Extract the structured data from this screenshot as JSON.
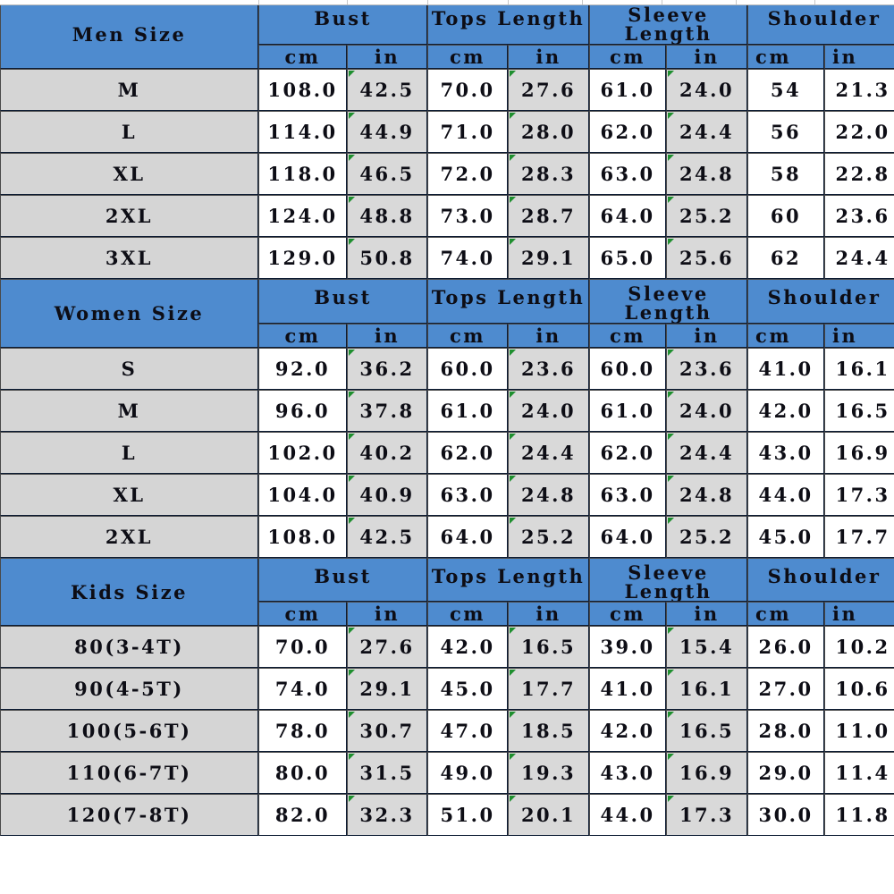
{
  "meta": {
    "colors": {
      "header_blue": "#4e8bcf",
      "row_gray": "#d5d5d5",
      "value_gray": "#d9d9d9",
      "value_white": "#ffffff",
      "text": "#0d0d15",
      "grid_dark": "#0c1b33",
      "error_marker_green": "#1f8f2f"
    }
  },
  "units": {
    "cm": "cm",
    "in": "in"
  },
  "measurements": {
    "bust": "Bust",
    "tops_length": "Tops Length",
    "sleeve_line1": "Sleeve",
    "sleeve_line2": "Length",
    "shoulder": "Shoulder"
  },
  "sections": [
    {
      "id": "men",
      "title": "Men Size",
      "rows": [
        {
          "size": "M",
          "bust_cm": "108.0",
          "bust_in": "42.5",
          "tops_cm": "70.0",
          "tops_in": "27.6",
          "sleeve_cm": "61.0",
          "sleeve_in": "24.0",
          "shoulder_cm": "54",
          "shoulder_in": "21.3"
        },
        {
          "size": "L",
          "bust_cm": "114.0",
          "bust_in": "44.9",
          "tops_cm": "71.0",
          "tops_in": "28.0",
          "sleeve_cm": "62.0",
          "sleeve_in": "24.4",
          "shoulder_cm": "56",
          "shoulder_in": "22.0"
        },
        {
          "size": "XL",
          "bust_cm": "118.0",
          "bust_in": "46.5",
          "tops_cm": "72.0",
          "tops_in": "28.3",
          "sleeve_cm": "63.0",
          "sleeve_in": "24.8",
          "shoulder_cm": "58",
          "shoulder_in": "22.8"
        },
        {
          "size": "2XL",
          "bust_cm": "124.0",
          "bust_in": "48.8",
          "tops_cm": "73.0",
          "tops_in": "28.7",
          "sleeve_cm": "64.0",
          "sleeve_in": "25.2",
          "shoulder_cm": "60",
          "shoulder_in": "23.6"
        },
        {
          "size": "3XL",
          "bust_cm": "129.0",
          "bust_in": "50.8",
          "tops_cm": "74.0",
          "tops_in": "29.1",
          "sleeve_cm": "65.0",
          "sleeve_in": "25.6",
          "shoulder_cm": "62",
          "shoulder_in": "24.4"
        }
      ],
      "shoulder_cm_align": "left"
    },
    {
      "id": "women",
      "title": "Women Size",
      "rows": [
        {
          "size": "S",
          "bust_cm": "92.0",
          "bust_in": "36.2",
          "tops_cm": "60.0",
          "tops_in": "23.6",
          "sleeve_cm": "60.0",
          "sleeve_in": "23.6",
          "shoulder_cm": "41.0",
          "shoulder_in": "16.1"
        },
        {
          "size": "M",
          "bust_cm": "96.0",
          "bust_in": "37.8",
          "tops_cm": "61.0",
          "tops_in": "24.0",
          "sleeve_cm": "61.0",
          "sleeve_in": "24.0",
          "shoulder_cm": "42.0",
          "shoulder_in": "16.5"
        },
        {
          "size": "L",
          "bust_cm": "102.0",
          "bust_in": "40.2",
          "tops_cm": "62.0",
          "tops_in": "24.4",
          "sleeve_cm": "62.0",
          "sleeve_in": "24.4",
          "shoulder_cm": "43.0",
          "shoulder_in": "16.9"
        },
        {
          "size": "XL",
          "bust_cm": "104.0",
          "bust_in": "40.9",
          "tops_cm": "63.0",
          "tops_in": "24.8",
          "sleeve_cm": "63.0",
          "sleeve_in": "24.8",
          "shoulder_cm": "44.0",
          "shoulder_in": "17.3"
        },
        {
          "size": "2XL",
          "bust_cm": "108.0",
          "bust_in": "42.5",
          "tops_cm": "64.0",
          "tops_in": "25.2",
          "sleeve_cm": "64.0",
          "sleeve_in": "25.2",
          "shoulder_cm": "45.0",
          "shoulder_in": "17.7"
        }
      ],
      "shoulder_cm_align": "right"
    },
    {
      "id": "kids",
      "title": "Kids Size",
      "rows": [
        {
          "size": "80(3-4T)",
          "bust_cm": "70.0",
          "bust_in": "27.6",
          "tops_cm": "42.0",
          "tops_in": "16.5",
          "sleeve_cm": "39.0",
          "sleeve_in": "15.4",
          "shoulder_cm": "26.0",
          "shoulder_in": "10.2"
        },
        {
          "size": "90(4-5T)",
          "bust_cm": "74.0",
          "bust_in": "29.1",
          "tops_cm": "45.0",
          "tops_in": "17.7",
          "sleeve_cm": "41.0",
          "sleeve_in": "16.1",
          "shoulder_cm": "27.0",
          "shoulder_in": "10.6"
        },
        {
          "size": "100(5-6T)",
          "bust_cm": "78.0",
          "bust_in": "30.7",
          "tops_cm": "47.0",
          "tops_in": "18.5",
          "sleeve_cm": "42.0",
          "sleeve_in": "16.5",
          "shoulder_cm": "28.0",
          "shoulder_in": "11.0"
        },
        {
          "size": "110(6-7T)",
          "bust_cm": "80.0",
          "bust_in": "31.5",
          "tops_cm": "49.0",
          "tops_in": "19.3",
          "sleeve_cm": "43.0",
          "sleeve_in": "16.9",
          "shoulder_cm": "29.0",
          "shoulder_in": "11.4"
        },
        {
          "size": "120(7-8T)",
          "bust_cm": "82.0",
          "bust_in": "32.3",
          "tops_cm": "51.0",
          "tops_in": "20.1",
          "sleeve_cm": "44.0",
          "sleeve_in": "17.3",
          "shoulder_cm": "30.0",
          "shoulder_in": "11.8"
        }
      ],
      "shoulder_cm_align": "right"
    }
  ]
}
